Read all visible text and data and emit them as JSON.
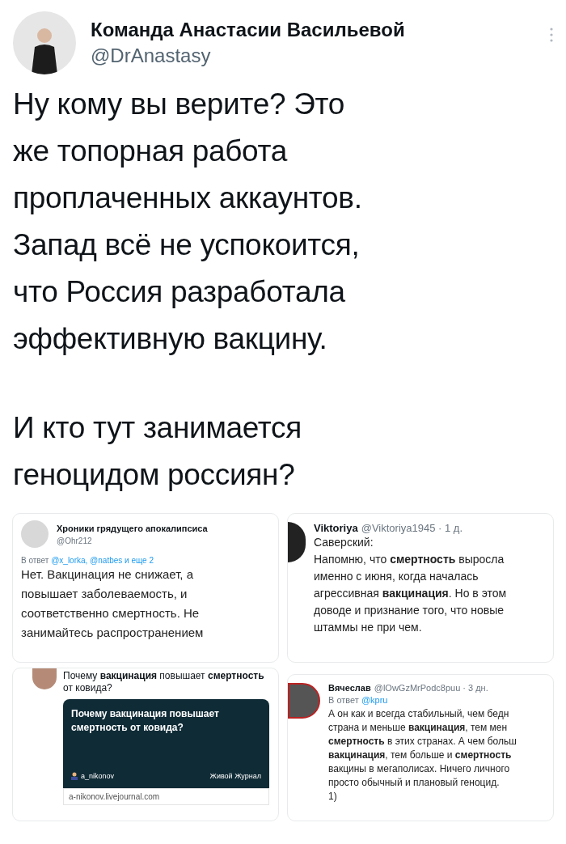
{
  "author": {
    "name": "Команда Анастасии Васильевой",
    "handle": "@DrAnastasy"
  },
  "tweet_text": [
    "Ну кому вы верите? Это\nже топорная работа\nпроплаченных аккаунтов.\nЗапад всё не успокоится,\nчто Россия разработала\nэффективную вакцину.",
    "И кто тут занимается\nгеноцидом россиян?"
  ],
  "screenshots": [
    {
      "kind": "reply",
      "name": "Хроники грядущего апокалипсиса",
      "handle": "@Ohr212",
      "reply_to": "В ответ",
      "mentions": "@x_lorka, @natbes и еще 2",
      "text": "Нет. Вакцинация не снижает, а\nповышает заболеваемость, и\nсоответственно смертность. Не\nзанимайтесь распространением"
    },
    {
      "kind": "inline",
      "name": "Viktoriya",
      "handle": "@Viktoriya1945 · 1 д.",
      "text": "Саверский:\nНапомню, что **смертность** выросла\nименно с июня, когда началась\nагрессивная **вакцинация**. Но в этом\nдоводе и признание того, что новые\nштаммы не при чем."
    },
    {
      "kind": "link",
      "text": "Почему **вакцинация** повышает **смертность**\nот ковида?",
      "card_title": "Почему вакцинация повышает смертность от ковида?",
      "card_author": "a_nikonov",
      "card_site": "Живой Журнал",
      "card_url": "a-nikonov.livejournal.com"
    },
    {
      "kind": "inline_reply",
      "name": "Вячеслав",
      "handle": "@lOwGzMrPodc8puu · 3 дн.",
      "reply_to": "В ответ",
      "mentions": "@kpru",
      "text": "А он как и всегда стабильный, чем бедн\nстрана и меньше **вакцинация**, тем мен\n**смертность** в этих странах. А чем больш\n**вакцинация**, тем больше и **смертность**\nвакцины в мегаполисах. Ничего личного\nпросто обычный и плановый геноцид.\n1)"
    }
  ]
}
